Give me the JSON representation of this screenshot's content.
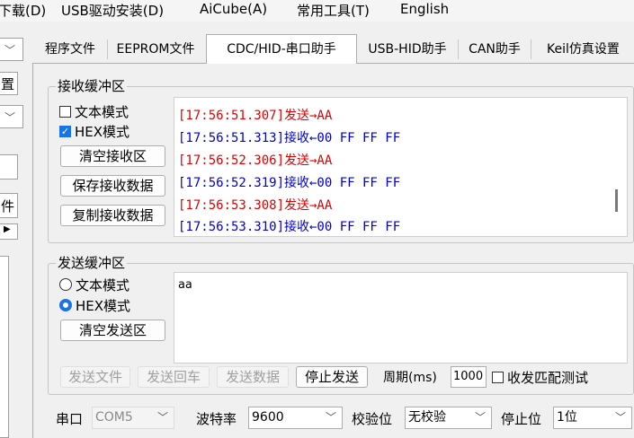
{
  "menu": [
    "下载(D)",
    "USB驱动安装(D)",
    "AiCube(A)",
    "常用工具(T)",
    "English"
  ],
  "left_panel": {
    "label1": "置",
    "label2": "件"
  },
  "tabs": [
    "程序文件",
    "EEPROM文件",
    "CDC/HID-串口助手",
    "USB-HID助手",
    "CAN助手",
    "Keil仿真设置"
  ],
  "active_tab": "CDC/HID-串口助手",
  "receive": {
    "title": "接收缓冲区",
    "text_mode": "文本模式",
    "hex_mode": "HEX模式",
    "text_mode_checked": false,
    "hex_mode_checked": true,
    "btn_clear": "清空接收区",
    "btn_save": "保存接收数据",
    "btn_copy": "复制接收数据",
    "log": [
      {
        "text": "[17:56:51.307]发送→AA",
        "color": "#e00000"
      },
      {
        "text": "[17:56:51.313]接收←00 FF FF FF",
        "color": "#0000d0"
      },
      {
        "text": "[17:56:52.306]发送→AA",
        "color": "#e00000"
      },
      {
        "text": "[17:56:52.319]接收←00 FF FF FF",
        "color": "#0000d0"
      },
      {
        "text": "[17:56:53.308]发送→AA",
        "color": "#e00000"
      },
      {
        "text": "[17:56:53.310]接收←00 FF FF FF",
        "color": "#0000d0"
      }
    ]
  },
  "send": {
    "title": "发送缓冲区",
    "text_mode": "文本模式",
    "hex_mode": "HEX模式",
    "selected": "hex",
    "btn_clear": "清空发送区",
    "content": "aa",
    "btn_send_file": "发送文件",
    "btn_send_enter": "发送回车",
    "btn_send_data": "发送数据",
    "btn_stop": "停止发送",
    "period_label": "周期(ms)",
    "period_value": "1000",
    "match_test_label": "收发匹配测试"
  },
  "port": {
    "port_label": "串口",
    "port_value": "COM5",
    "baud_label": "波特率",
    "baud_value": "9600",
    "parity_label": "校验位",
    "parity_value": "无校验",
    "stop_label": "停止位",
    "stop_value": "1位"
  }
}
